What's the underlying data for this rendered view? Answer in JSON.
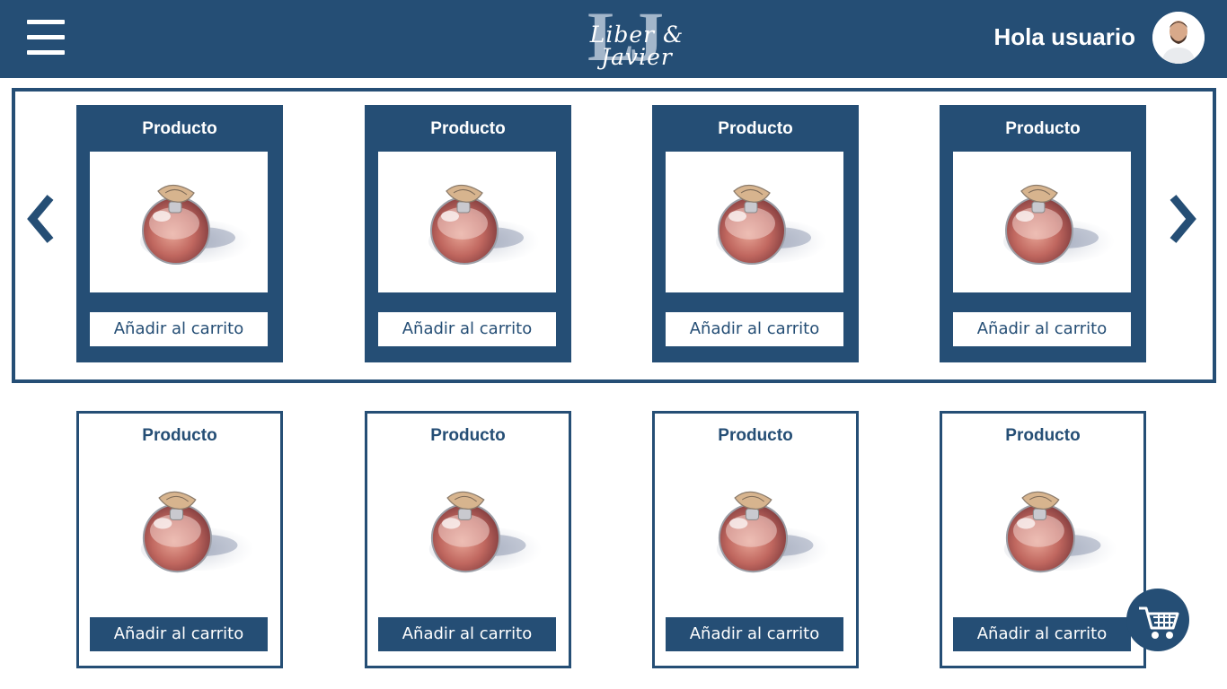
{
  "header": {
    "menu_icon": "hamburger-menu-icon",
    "logo": {
      "monogram": "LJ",
      "script_text": "Liber & Javier"
    },
    "greeting": "Hola usuario",
    "avatar_icon": "user-avatar"
  },
  "carousel": {
    "prev_icon": "chevron-left-icon",
    "next_icon": "chevron-right-icon",
    "items": [
      {
        "title": "Producto",
        "button": "Añadir al carrito"
      },
      {
        "title": "Producto",
        "button": "Añadir al carrito"
      },
      {
        "title": "Producto",
        "button": "Añadir al carrito"
      },
      {
        "title": "Producto",
        "button": "Añadir al carrito"
      }
    ]
  },
  "grid": {
    "items": [
      {
        "title": "Producto",
        "button": "Añadir al carrito"
      },
      {
        "title": "Producto",
        "button": "Añadir al carrito"
      },
      {
        "title": "Producto",
        "button": "Añadir al carrito"
      },
      {
        "title": "Producto",
        "button": "Añadir al carrito"
      }
    ]
  },
  "cart_fab": {
    "icon": "shopping-cart-icon"
  },
  "colors": {
    "primary": "#254e75",
    "monogram": "#a3b6ca",
    "background": "#ffffff"
  }
}
